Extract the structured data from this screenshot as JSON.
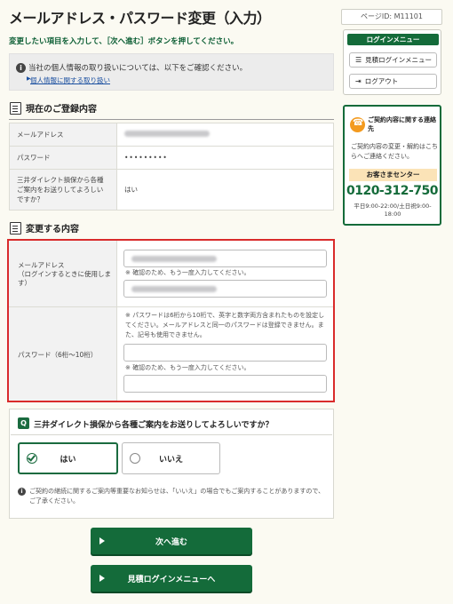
{
  "header": {
    "title": "メールアドレス・パスワード変更（入力）",
    "page_id": "ページID: M11101",
    "instruction": "変更したい項目を入力して、［次へ進む］ボタンを押してください。"
  },
  "privacy": {
    "text": "当社の個人情報の取り扱いについては、以下をご確認ください。",
    "link": "個人情報に関する取り扱い"
  },
  "current": {
    "heading": "現在のご登録内容",
    "rows": [
      {
        "label": "メールアドレス",
        "value": ""
      },
      {
        "label": "パスワード",
        "value": "•••••••••"
      },
      {
        "label": "三井ダイレクト損保から各種ご案内をお送りしてよろしいですか？",
        "value": "はい"
      }
    ]
  },
  "change": {
    "heading": "変更する内容",
    "email_label": "メールアドレス",
    "email_sub": "（ログインするときに使用します）",
    "email_confirm_note": "※ 確認のため、もう一度入力してください。",
    "password_label": "パスワード（6桁～10桁）",
    "password_note": "※ パスワードは6桁から10桁で、英字と数字両方含まれたものを設定してください。メールアドレスと同一のパスワードは登録できません。また、記号も使用できません。",
    "password_confirm_note": "※ 確認のため、もう一度入力してください。"
  },
  "question": {
    "q_badge": "Q",
    "text": "三井ダイレクト損保から各種ご案内をお送りしてよろしいですか？",
    "yes": "はい",
    "no": "いいえ",
    "note": "ご契約の継続に関するご案内等重要なお知らせは、「いいえ」の場合でもご案内することがありますので、ご了承ください。"
  },
  "buttons": {
    "next": "次へ進む",
    "back": "見積ログインメニューへ"
  },
  "sidebar": {
    "menu_title": "ログインメニュー",
    "estimate_login": "見積ログインメニュー",
    "logout": "ログアウト",
    "contact_title": "ご契約内容に関する連絡先",
    "contact_desc": "ご契約内容の変更・解約はこちらへご連絡ください。",
    "center": "お客さまセンター",
    "phone": "0120-312-750",
    "hours": "平日9:00-22:00/土日祝9:00-18:00"
  },
  "colors": {
    "brand_green": "#146b3a",
    "alert_red": "#d92b2b",
    "accent_orange": "#f39a1e"
  }
}
